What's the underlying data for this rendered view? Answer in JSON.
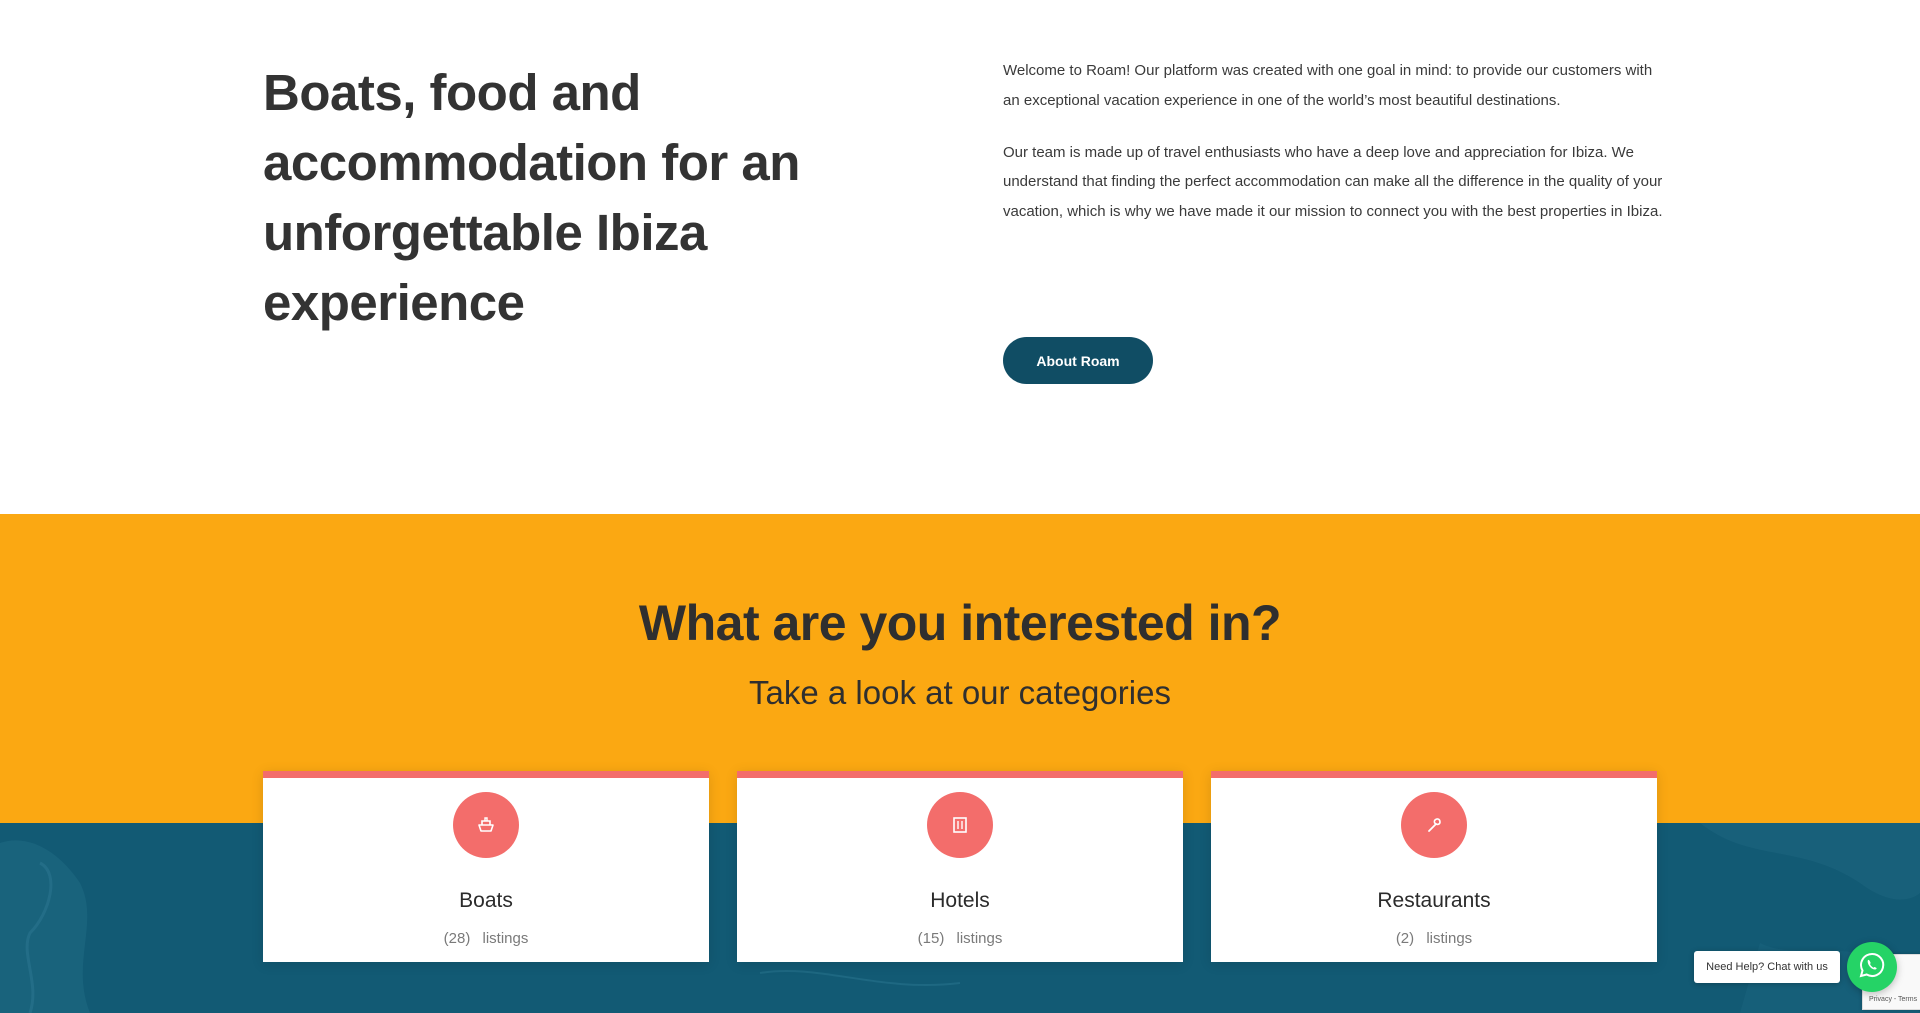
{
  "intro": {
    "title": "Boats, food and accommodation for an unforgettable Ibiza experience",
    "paragraph1": "Welcome to Roam! Our platform was created with one goal in mind: to provide our customers with an exceptional vacation experience in one of the world’s most beautiful destinations.",
    "paragraph2": "Our team is made up of travel enthusiasts who have a deep love and appreciation for Ibiza. We understand that finding the perfect accommodation can make all the difference in the quality of your vacation, which is why we have made it our mission to connect you with the best properties in Ibiza.",
    "button_label": "About Roam"
  },
  "categories": {
    "title": "What are you interested in?",
    "subtitle": "Take a look at our categories",
    "items": [
      {
        "name": "Boats",
        "count": "(28)",
        "count_label": "listings",
        "icon": "boat-icon"
      },
      {
        "name": "Hotels",
        "count": "(15)",
        "count_label": "listings",
        "icon": "building-icon"
      },
      {
        "name": "Restaurants",
        "count": "(2)",
        "count_label": "listings",
        "icon": "utensil-icon"
      }
    ]
  },
  "chat": {
    "label": "Need Help? Chat with us",
    "icon": "whatsapp-icon"
  },
  "recaptcha": {
    "links": "Privacy - Terms"
  },
  "colors": {
    "accent_dark": "#104d64",
    "yellow": "#fba812",
    "blue": "#125a74",
    "coral": "#f36d6b",
    "whatsapp": "#25d366"
  }
}
